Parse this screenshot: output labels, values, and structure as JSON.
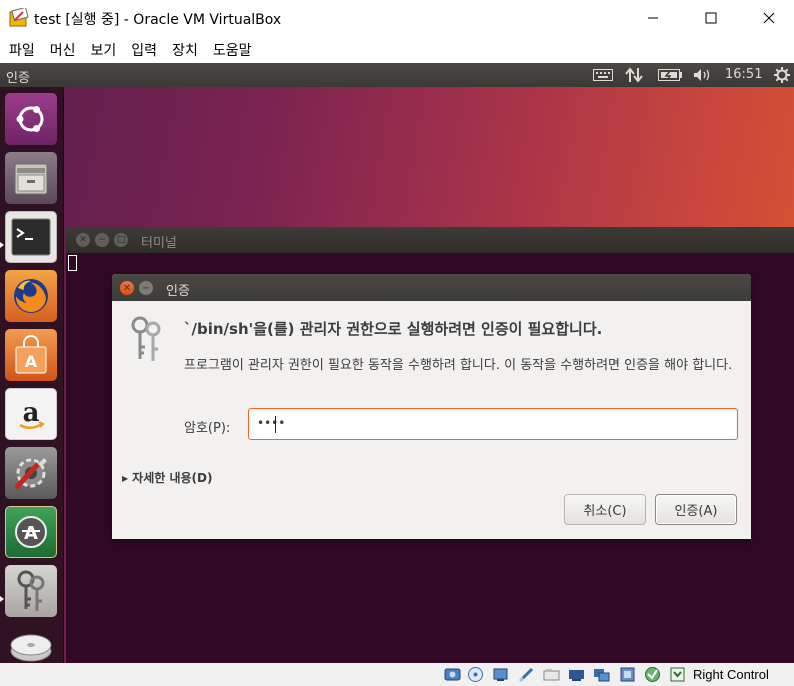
{
  "window": {
    "title": "test [실행 중] - Oracle VM VirtualBox",
    "controls": {
      "minimize_icon": "minimize-icon",
      "maximize_icon": "maximize-icon",
      "close_icon": "close-icon"
    }
  },
  "menubar": {
    "items": [
      {
        "label": "파일"
      },
      {
        "label": "머신"
      },
      {
        "label": "보기"
      },
      {
        "label": "입력"
      },
      {
        "label": "장치"
      },
      {
        "label": "도움말"
      }
    ]
  },
  "ubuntu_panel": {
    "title": "인증",
    "indicators": [
      "keyboard-icon",
      "network-transfer-icon",
      "battery-icon",
      "volume-icon"
    ],
    "clock": "16:51",
    "settings_icon": "gear-icon"
  },
  "launcher": {
    "items": [
      {
        "name": "ubuntu-dash",
        "icon": "ubuntu-logo-icon"
      },
      {
        "name": "files",
        "icon": "file-cabinet-icon"
      },
      {
        "name": "terminal",
        "icon": "terminal-icon",
        "running": true
      },
      {
        "name": "firefox",
        "icon": "firefox-icon"
      },
      {
        "name": "software-center",
        "icon": "shopping-bag-icon"
      },
      {
        "name": "amazon",
        "icon": "amazon-icon"
      },
      {
        "name": "system-settings",
        "icon": "settings-tools-icon"
      },
      {
        "name": "software-updater",
        "icon": "updater-icon"
      },
      {
        "name": "authentication",
        "icon": "keys-icon",
        "running": true
      },
      {
        "name": "optical-drive",
        "icon": "disc-icon"
      }
    ]
  },
  "terminal": {
    "title": "터미널"
  },
  "auth_dialog": {
    "title": "인증",
    "heading": "`/bin/sh'을(를) 관리자 권한으로 실행하려면 인증이 필요합니다.",
    "description": "프로그램이 관리자 권한이 필요한 동작을 수행하려 합니다. 이 동작을 수행하려면 인증을 해야 합니다.",
    "password_label": "암호(P):",
    "password_value": "••••",
    "details_label": "자세한 내용(D)",
    "cancel_label": "취소(C)",
    "authenticate_label": "인증(A)",
    "accent_color": "#e9692c"
  },
  "statusbar": {
    "icons": [
      "hard-disk-icon",
      "optical-disc-icon",
      "audio-icon",
      "network-icon",
      "usb-icon",
      "shared-folder-icon",
      "display-icon",
      "video-capture-icon",
      "cpu-icon",
      "mouse-integration-icon",
      "arrow-down-icon"
    ],
    "host_key": "Right Control"
  }
}
